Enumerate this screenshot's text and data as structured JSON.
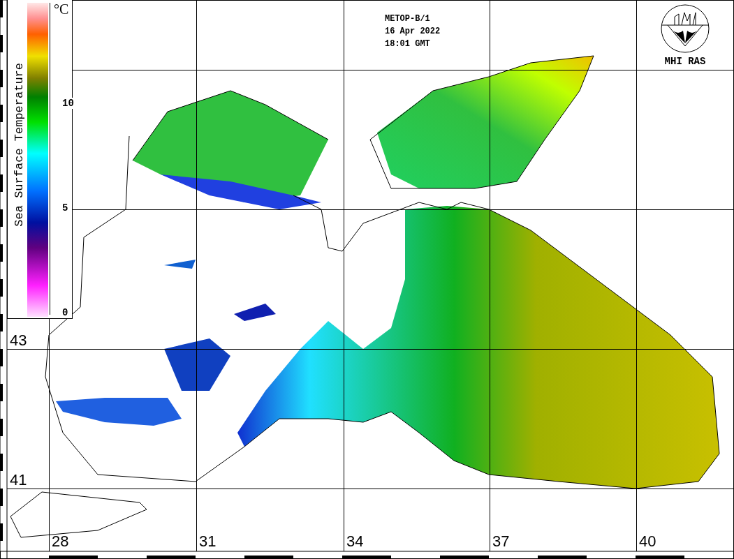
{
  "header": {
    "satellite": "METOP-B/1",
    "date": "16 Apr 2022",
    "time": "18:01 GMT"
  },
  "logo": {
    "caption": "MHI RAS"
  },
  "legend": {
    "title": "Sea Surface Temperature",
    "unit": "°C",
    "ticks": [
      "10",
      "5",
      "0"
    ]
  },
  "latitude_labels": [
    "43",
    "41"
  ],
  "longitude_labels": [
    "28",
    "31",
    "34",
    "37",
    "40"
  ]
}
